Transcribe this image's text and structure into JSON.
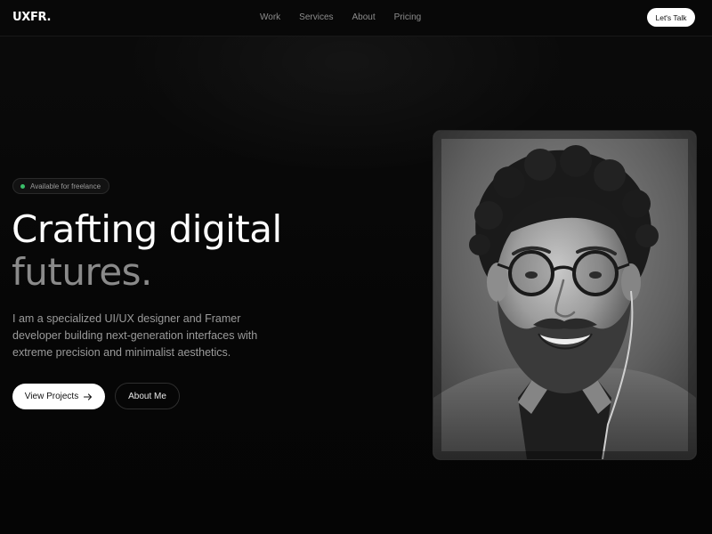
{
  "nav": {
    "logo": "UXFR.",
    "links": [
      "Work",
      "Services",
      "About",
      "Pricing"
    ],
    "cta_label": "Let's Talk"
  },
  "hero": {
    "badge": "Available for freelance",
    "headline_line1": "Crafting digital",
    "headline_line2": "futures.",
    "description": "I am a specialized UI/UX designer and Framer developer building next-generation interfaces with extreme precision and minimalist aesthetics.",
    "primary_button": "View Projects",
    "secondary_button": "About Me"
  },
  "colors": {
    "background": "#070707",
    "accent_text": "#ffffff",
    "muted_text": "#8a8a8a",
    "status_dot": "#3bbf6a"
  },
  "icons": {
    "primary_button_icon": "arrow-right-icon",
    "badge_icon": "status-dot-icon"
  }
}
